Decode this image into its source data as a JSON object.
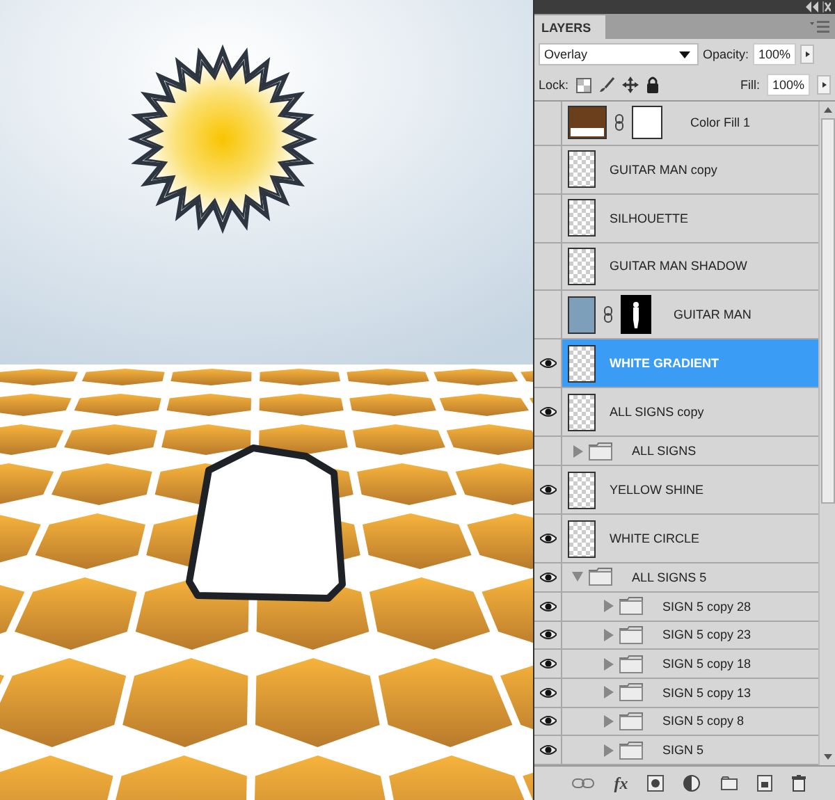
{
  "panel": {
    "title": "LAYERS",
    "blend_mode": "Overlay",
    "opacity_label": "Opacity:",
    "opacity": "100%",
    "lock_label": "Lock:",
    "fill_label": "Fill:",
    "fill": "100%",
    "fx_label": "fx"
  },
  "layers": [
    {
      "name": "Color Fill 1",
      "kind": "fill",
      "visible": false,
      "selected": false
    },
    {
      "name": "GUITAR MAN copy",
      "kind": "layer",
      "visible": false,
      "selected": false
    },
    {
      "name": "SILHOUETTE",
      "kind": "layer",
      "visible": false,
      "selected": false
    },
    {
      "name": "GUITAR MAN SHADOW",
      "kind": "layer",
      "visible": false,
      "selected": false
    },
    {
      "name": "GUITAR MAN",
      "kind": "masked",
      "visible": false,
      "selected": false
    },
    {
      "name": "WHITE GRADIENT",
      "kind": "layer",
      "visible": true,
      "selected": true
    },
    {
      "name": "ALL SIGNS copy",
      "kind": "layer",
      "visible": true,
      "selected": false
    },
    {
      "name": "ALL SIGNS",
      "kind": "group",
      "visible": false,
      "selected": false,
      "expanded": false
    },
    {
      "name": "YELLOW SHINE",
      "kind": "layer",
      "visible": true,
      "selected": false
    },
    {
      "name": "WHITE CIRCLE",
      "kind": "layer",
      "visible": true,
      "selected": false
    },
    {
      "name": "ALL SIGNS 5",
      "kind": "group",
      "visible": true,
      "selected": false,
      "expanded": true,
      "children": [
        {
          "name": "SIGN 5 copy 28",
          "kind": "group",
          "visible": true,
          "selected": false,
          "expanded": false
        },
        {
          "name": "SIGN 5 copy 23",
          "kind": "group",
          "visible": true,
          "selected": false,
          "expanded": false
        },
        {
          "name": "SIGN 5 copy 18",
          "kind": "group",
          "visible": true,
          "selected": false,
          "expanded": false
        },
        {
          "name": "SIGN 5 copy 13",
          "kind": "group",
          "visible": true,
          "selected": false,
          "expanded": false
        },
        {
          "name": "SIGN 5 copy 8",
          "kind": "group",
          "visible": true,
          "selected": false,
          "expanded": false
        },
        {
          "name": "SIGN 5",
          "kind": "group",
          "visible": true,
          "selected": false,
          "expanded": false
        }
      ]
    }
  ]
}
